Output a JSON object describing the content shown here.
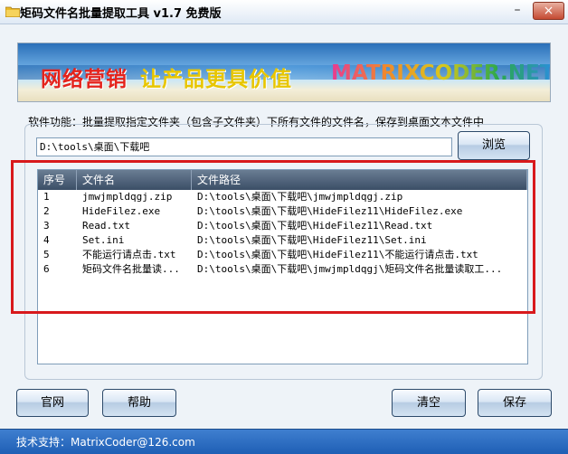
{
  "window": {
    "title": "矩码文件名批量提取工具 v1.7 免费版",
    "minimize": "–",
    "close": "×"
  },
  "banner": {
    "slogan_1": "网络营销",
    "slogan_2": "让产品更具价值",
    "site": "MATRIXCODER.NET"
  },
  "description": "软件功能：批量提取指定文件夹（包含子文件夹）下所有文件的文件名，保存到桌面文本文件中",
  "path": {
    "value": "D:\\tools\\桌面\\下载吧",
    "browse_label": "浏览"
  },
  "list": {
    "columns": [
      "序号",
      "文件名",
      "文件路径"
    ],
    "rows": [
      {
        "index": "1",
        "name": "jmwjmpldqgj.zip",
        "path": "D:\\tools\\桌面\\下载吧\\jmwjmpldqgj.zip"
      },
      {
        "index": "2",
        "name": "HideFilez.exe",
        "path": "D:\\tools\\桌面\\下载吧\\HideFilez11\\HideFilez.exe"
      },
      {
        "index": "3",
        "name": "Read.txt",
        "path": "D:\\tools\\桌面\\下载吧\\HideFilez11\\Read.txt"
      },
      {
        "index": "4",
        "name": "Set.ini",
        "path": "D:\\tools\\桌面\\下载吧\\HideFilez11\\Set.ini"
      },
      {
        "index": "5",
        "name": "不能运行请点击.txt",
        "path": "D:\\tools\\桌面\\下载吧\\HideFilez11\\不能运行请点击.txt"
      },
      {
        "index": "6",
        "name": "矩码文件名批量读...",
        "path": "D:\\tools\\桌面\\下载吧\\jmwjmpldqgj\\矩码文件名批量读取工..."
      }
    ]
  },
  "buttons": {
    "website": "官网",
    "help": "帮助",
    "clear": "清空",
    "save": "保存"
  },
  "status": {
    "support": "技术支持：MatrixCoder@126.com"
  },
  "colors": {
    "highlight": "#d8191c",
    "statusbar": "#2a6cc4",
    "header": "#4a5d75"
  }
}
